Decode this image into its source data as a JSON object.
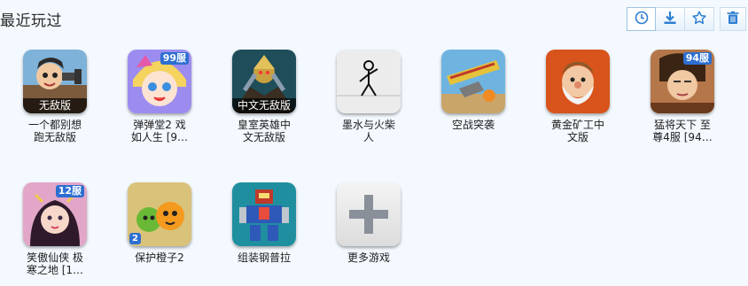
{
  "section_title": "最近玩过",
  "toolbar": {
    "history_icon": "clock-icon",
    "download_icon": "download-icon",
    "favorite_icon": "star-icon",
    "delete_icon": "trash-icon",
    "accent": "#2d6fd1"
  },
  "games": [
    {
      "name": "一个都别想跑无敌版",
      "badge_bottom": "无敌版"
    },
    {
      "name": "弹弹堂2 戏如人生 [9…",
      "badge_top": "99服"
    },
    {
      "name": "皇室英雄中文无敌版",
      "badge_bottom": "中文无敌版"
    },
    {
      "name": "墨水与火柴人"
    },
    {
      "name": "空战突袭"
    },
    {
      "name": "黄金矿工中文版"
    },
    {
      "name": "猛将天下 至尊4服 [94…",
      "badge_top": "94服"
    },
    {
      "name": "笑傲仙侠 极寒之地 [1…",
      "badge_top": "12服"
    },
    {
      "name": "保护橙子2",
      "badge_num": "2"
    },
    {
      "name": "组装钢普拉"
    },
    {
      "name": "更多游戏"
    }
  ]
}
